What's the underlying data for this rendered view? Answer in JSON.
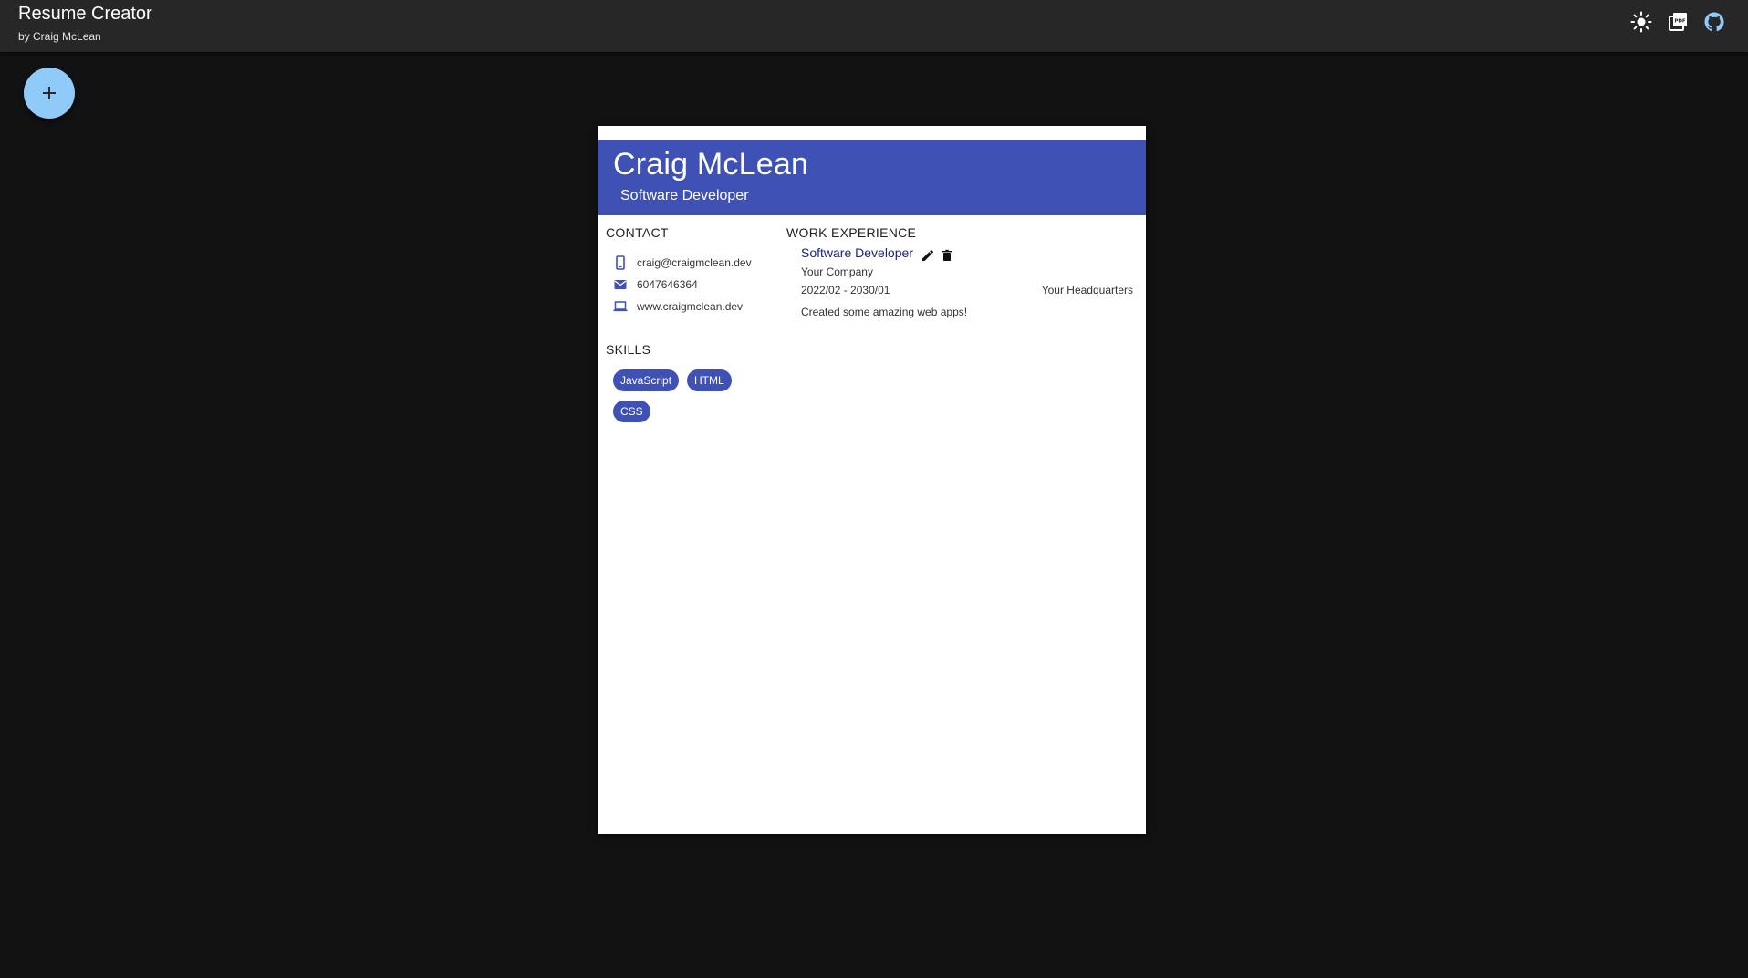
{
  "app": {
    "title": "Resume Creator",
    "subtitle": "by Craig McLean",
    "actions": [
      "theme-toggle",
      "export-pdf",
      "github"
    ]
  },
  "fab": {
    "label": "+"
  },
  "resume": {
    "name": "Craig McLean",
    "role": "Software Developer",
    "contact": {
      "heading": "CONTACT",
      "email": "craig@craigmclean.dev",
      "phone": "6047646364",
      "website": "www.craigmclean.dev"
    },
    "skills": {
      "heading": "SKILLS",
      "items": [
        "JavaScript",
        "HTML",
        "CSS"
      ]
    },
    "work": {
      "heading": "WORK EXPERIENCE",
      "jobs": [
        {
          "title": "Software Developer",
          "company": "Your Company",
          "dates": "2022/02 - 2030/01",
          "location": "Your Headquarters",
          "description": "Created some amazing web apps!"
        }
      ]
    }
  },
  "colors": {
    "background": "#121212",
    "appbar": "#272727",
    "primary": "#3f51b5",
    "fab": "#90caf9",
    "job_title": "#1a237e"
  }
}
